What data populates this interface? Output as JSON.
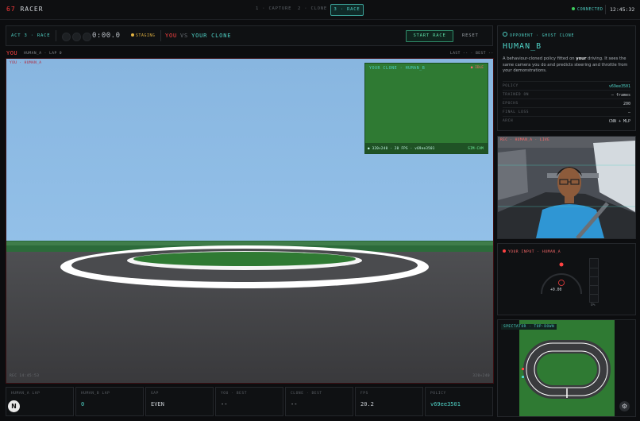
{
  "app": {
    "logo_accent": "67",
    "logo_rest": "RACER"
  },
  "steps": [
    {
      "label": "1 · CAPTURE",
      "active": false
    },
    {
      "label": "2 · CLONE",
      "active": false
    },
    {
      "label": "3 · RACE",
      "active": true
    }
  ],
  "status": {
    "connection": "CONNECTED",
    "time": "12:45:32"
  },
  "race_header": {
    "act_label": "ACT 3 · RACE",
    "timer": "0:00.0",
    "state": "STAGING",
    "you": "YOU",
    "vs": "VS",
    "opponent": "YOUR CLONE",
    "start_button": "START RACE",
    "reset_button": "RESET"
  },
  "lap_row": {
    "you_label": "YOU",
    "you_lap": "HUMAN_A · LAP 0",
    "last_best": "LAST -- · BEST --"
  },
  "main_view": {
    "hud_top_left": "YOU · HUMAN_A",
    "hud_bottom_left": "REC 14:45:53",
    "hud_bottom_right": "320×240"
  },
  "clone_pip": {
    "title": "YOUR CLONE · HUMAN_B",
    "status": "● IDLE",
    "footer_left": "● 320×240 · 20 FPS · v69ee3501",
    "footer_right": "SIM·CAM"
  },
  "stats": [
    {
      "label": "HUMAN_A LAP",
      "value": ""
    },
    {
      "label": "HUMAN_B LAP",
      "value": "0",
      "accent": true
    },
    {
      "label": "GAP",
      "value": "EVEN"
    },
    {
      "label": "YOU · BEST",
      "value": "--"
    },
    {
      "label": "CLONE · BEST",
      "value": "--"
    },
    {
      "label": "FPS",
      "value": "20.2"
    },
    {
      "label": "POLICY",
      "value": "v69ee3501",
      "accent": true
    }
  ],
  "badge": "N",
  "opponent": {
    "header": "OPPONENT · GHOST CLONE",
    "name": "HUMAN_B",
    "desc_pre": "A behaviour-cloned policy fitted on ",
    "desc_bold": "your",
    "desc_post": " driving. It sees the same camera you do and predicts steering and throttle from your demonstrations.",
    "rows": [
      {
        "key": "POLICY",
        "value": "v69ee3501",
        "accent": true
      },
      {
        "key": "TRAINED ON",
        "value": "— frames"
      },
      {
        "key": "EPOCHS",
        "value": "200"
      },
      {
        "key": "FINAL LOSS",
        "value": "—"
      },
      {
        "key": "ARCH",
        "value": "CNN + MLP"
      }
    ]
  },
  "camera": {
    "label": "REC · HUMAN_A · LIVE"
  },
  "input": {
    "header": "YOUR INPUT · HUMAN_A",
    "steer_value": "+0.00",
    "throttle_label": "0%",
    "throttle_level": 0
  },
  "spectator": {
    "title": "SPECTATOR · TOP-DOWN"
  },
  "colors": {
    "accent": "#4fd1c5",
    "you": "#ff4242",
    "warn": "#e3b341"
  }
}
